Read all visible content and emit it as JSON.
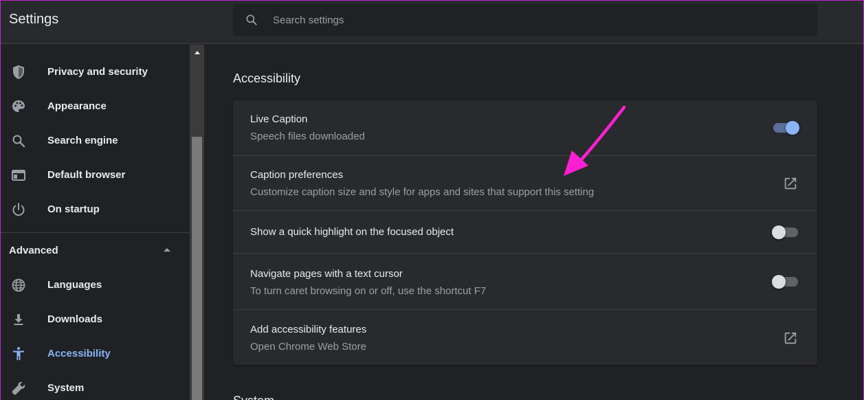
{
  "header": {
    "title": "Settings",
    "search": {
      "placeholder": "Search settings",
      "value": ""
    }
  },
  "sidebar": {
    "items": [
      {
        "label": "Privacy and security",
        "icon": "shield-icon"
      },
      {
        "label": "Appearance",
        "icon": "palette-icon"
      },
      {
        "label": "Search engine",
        "icon": "search-icon"
      },
      {
        "label": "Default browser",
        "icon": "browser-window-icon"
      },
      {
        "label": "On startup",
        "icon": "power-icon"
      }
    ],
    "advanced": {
      "label": "Advanced",
      "expanded": true
    },
    "advanced_items": [
      {
        "label": "Languages",
        "icon": "globe-icon"
      },
      {
        "label": "Downloads",
        "icon": "download-icon"
      },
      {
        "label": "Accessibility",
        "icon": "accessibility-icon",
        "active": true
      },
      {
        "label": "System",
        "icon": "wrench-icon"
      }
    ]
  },
  "main": {
    "section_title": "Accessibility",
    "rows": [
      {
        "title": "Live Caption",
        "subtitle": "Speech files downloaded",
        "control": "toggle",
        "on": true
      },
      {
        "title": "Caption preferences",
        "subtitle": "Customize caption size and style for apps and sites that support this setting",
        "control": "external-link"
      },
      {
        "title": "Show a quick highlight on the focused object",
        "subtitle": "",
        "control": "toggle",
        "on": false
      },
      {
        "title": "Navigate pages with a text cursor",
        "subtitle": "To turn caret browsing on or off, use the shortcut F7",
        "control": "toggle",
        "on": false
      },
      {
        "title": "Add accessibility features",
        "subtitle": "Open Chrome Web Store",
        "control": "external-link"
      }
    ],
    "next_section_title": "System"
  },
  "colors": {
    "accent": "#8ab4f8",
    "background": "#202124",
    "card": "#292a2d",
    "annotation": "#ff1fd2"
  }
}
